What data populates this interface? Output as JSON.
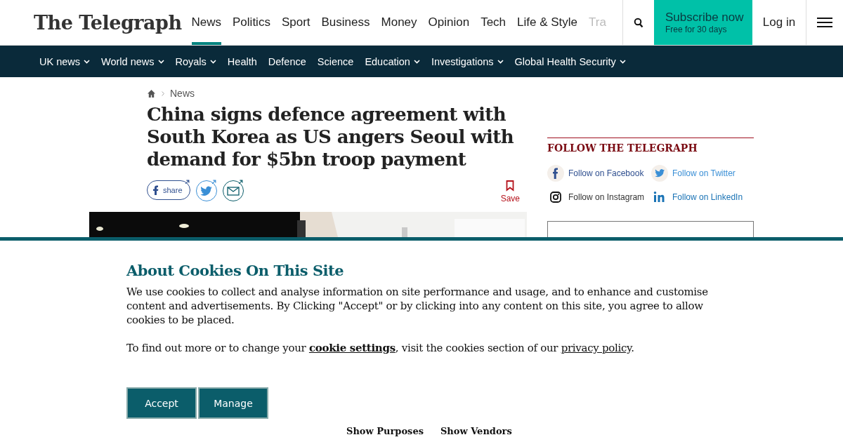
{
  "header": {
    "logo": "The Telegraph",
    "nav": [
      {
        "label": "News",
        "selected": true,
        "faded": false
      },
      {
        "label": "Politics",
        "selected": false,
        "faded": false
      },
      {
        "label": "Sport",
        "selected": false,
        "faded": false
      },
      {
        "label": "Business",
        "selected": false,
        "faded": false
      },
      {
        "label": "Money",
        "selected": false,
        "faded": false
      },
      {
        "label": "Opinion",
        "selected": false,
        "faded": false
      },
      {
        "label": "Tech",
        "selected": false,
        "faded": false
      },
      {
        "label": "Life & Style",
        "selected": false,
        "faded": false
      },
      {
        "label": "Tra",
        "selected": false,
        "faded": true
      }
    ],
    "subscribe": {
      "title": "Subscribe now",
      "subtitle": "Free for 30 days"
    },
    "login": "Log in"
  },
  "subnav": [
    {
      "label": "UK news",
      "has_menu": true
    },
    {
      "label": "World news",
      "has_menu": true
    },
    {
      "label": "Royals",
      "has_menu": true
    },
    {
      "label": "Health",
      "has_menu": false
    },
    {
      "label": "Defence",
      "has_menu": false
    },
    {
      "label": "Science",
      "has_menu": false
    },
    {
      "label": "Education",
      "has_menu": true
    },
    {
      "label": "Investigations",
      "has_menu": true
    },
    {
      "label": "Global Health Security",
      "has_menu": true
    }
  ],
  "article": {
    "breadcrumb": "News",
    "headline": "China signs defence agreement with South Korea as US angers Seoul with demand for $5bn troop payment",
    "share_label": "share",
    "save_label": "Save"
  },
  "sidebar": {
    "heading": "FOLLOW THE TELEGRAPH",
    "follow": [
      {
        "kind": "facebook",
        "label": "Follow on Facebook",
        "color": "#2f4f8f"
      },
      {
        "kind": "twitter",
        "label": "Follow on Twitter",
        "color": "#3a8fd6"
      },
      {
        "kind": "instagram",
        "label": "Follow on Instagram",
        "color": "#333333"
      },
      {
        "kind": "linkedin",
        "label": "Follow on LinkedIn",
        "color": "#1a73b5"
      }
    ]
  },
  "cookie_banner": {
    "title": "About Cookies On This Site",
    "body": "We use cookies to collect and analyse information on site performance and usage, and to enhance and customise content and advertisements. By Clicking \"Accept\" or by clicking into any content on this site, you agree to allow cookies to be placed.",
    "more": {
      "text_before": "To find out more or to change your ",
      "link": "cookie settings",
      "text_middle": ", visit the cookies section of our ",
      "link2": "privacy policy",
      "text_after": "."
    },
    "buttons": [
      "Accept",
      "Manage"
    ],
    "links": [
      "Show Purposes",
      "Show Vendors"
    ]
  }
}
